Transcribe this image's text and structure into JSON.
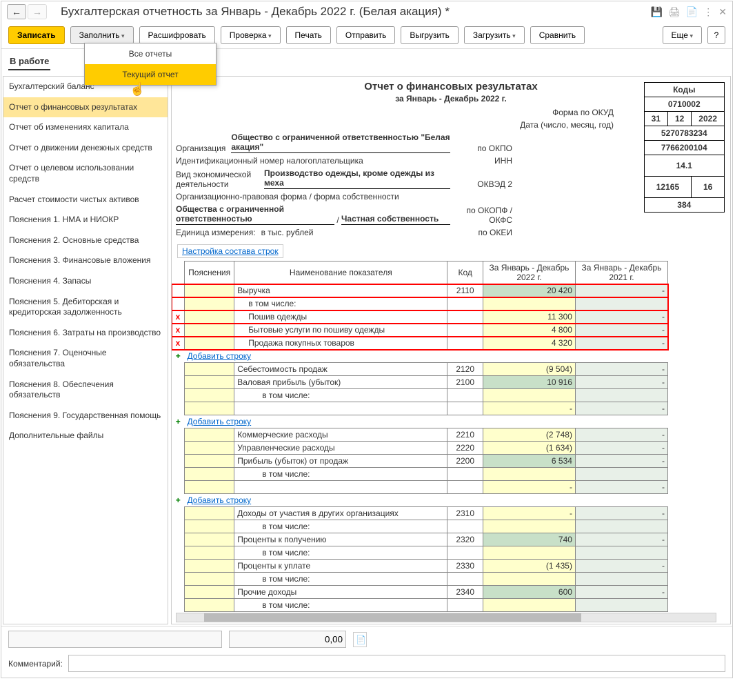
{
  "title": "Бухгалтерская отчетность за Январь - Декабрь 2022 г. (Белая акация) *",
  "toolbar": {
    "save": "Записать",
    "fill": "Заполнить",
    "decode": "Расшифровать",
    "check": "Проверка",
    "print": "Печать",
    "send": "Отправить",
    "upload": "Выгрузить",
    "download": "Загрузить",
    "compare": "Сравнить",
    "more": "Еще",
    "help": "?"
  },
  "fill_menu": {
    "all": "Все отчеты",
    "current": "Текущий отчет"
  },
  "tab": "В работе",
  "sidebar": [
    "Бухгалтерский баланс",
    "Отчет о финансовых результатах",
    "Отчет об изменениях капитала",
    "Отчет о движении денежных средств",
    "Отчет о целевом использовании средств",
    "Расчет стоимости чистых активов",
    "Пояснения 1. НМА и НИОКР",
    "Пояснения 2. Основные средства",
    "Пояснения 3. Финансовые вложения",
    "Пояснения 4. Запасы",
    "Пояснения 5. Дебиторская и кредиторская задолженность",
    "Пояснения 6. Затраты на производство",
    "Пояснения 7. Оценочные обязательства",
    "Пояснения 8. Обеспечения обязательств",
    "Пояснения 9. Государственная помощь",
    "Дополнительные файлы"
  ],
  "report": {
    "title": "Отчет о финансовых результатах",
    "period": "за Январь - Декабрь 2022 г.",
    "codes_header": "Коды",
    "okud_label": "Форма по ОКУД",
    "okud": "0710002",
    "date_label": "Дата (число, месяц, год)",
    "date_d": "31",
    "date_m": "12",
    "date_y": "2022",
    "org_label": "Организация",
    "org": "Общество с ограниченной ответственностью \"Белая акация\"",
    "okpo_label": "по ОКПО",
    "okpo": "5270783234",
    "inn_label": "Идентификационный номер налогоплательщика",
    "inn_code": "ИНН",
    "inn": "7766200104",
    "activity_label": "Вид экономической деятельности",
    "activity": "Производство одежды, кроме одежды из меха",
    "okved_label": "ОКВЭД 2",
    "okved": "14.1",
    "form_org_label": "Организационно-правовая форма / форма собственности",
    "form_org1": "Общества с ограниченной ответственностью",
    "form_org2": "Частная собственность",
    "okopf_label": "по ОКОПФ / ОКФС",
    "okopf1": "12165",
    "okopf2": "16",
    "unit_label": "Единица измерения:",
    "unit": "в тыс. рублей",
    "okei_label": "по ОКЕИ",
    "okei": "384",
    "settings_link": "Настройка состава строк",
    "headers": {
      "expl": "Пояснения",
      "name": "Наименование показателя",
      "code": "Код",
      "cur": "За Январь - Декабрь 2022 г.",
      "prev": "За Январь - Декабрь 2021 г."
    },
    "add_row": "Добавить строку",
    "rows": {
      "revenue": {
        "name": "Выручка",
        "code": "2110",
        "cur": "20 420",
        "prev": "-"
      },
      "incl": "в том числе:",
      "sewing": {
        "name": "Пошив одежды",
        "cur": "11 300",
        "prev": "-"
      },
      "services": {
        "name": "Бытовые услуги по пошиву одежды",
        "cur": "4 800",
        "prev": "-"
      },
      "resale": {
        "name": "Продажа покупных товаров",
        "cur": "4 320",
        "prev": "-"
      },
      "cost": {
        "name": "Себестоимость продаж",
        "code": "2120",
        "cur": "(9 504)",
        "prev": "-"
      },
      "gross": {
        "name": "Валовая прибыль (убыток)",
        "code": "2100",
        "cur": "10 916",
        "prev": "-"
      },
      "comm": {
        "name": "Коммерческие расходы",
        "code": "2210",
        "cur": "(2 748)",
        "prev": "-"
      },
      "mgmt": {
        "name": "Управленческие расходы",
        "code": "2220",
        "cur": "(1 634)",
        "prev": "-"
      },
      "sales_profit": {
        "name": "Прибыль (убыток) от продаж",
        "code": "2200",
        "cur": "6 534",
        "prev": "-"
      },
      "part_income": {
        "name": "Доходы от участия в других организациях",
        "code": "2310",
        "cur": "-",
        "prev": "-"
      },
      "int_recv": {
        "name": "Проценты к получению",
        "code": "2320",
        "cur": "740",
        "prev": "-"
      },
      "int_pay": {
        "name": "Проценты к уплате",
        "code": "2330",
        "cur": "(1 435)",
        "prev": "-"
      },
      "other_inc": {
        "name": "Прочие доходы",
        "code": "2340",
        "cur": "600",
        "prev": "-"
      }
    }
  },
  "footer": {
    "value": "0,00",
    "comment_label": "Комментарий:"
  }
}
